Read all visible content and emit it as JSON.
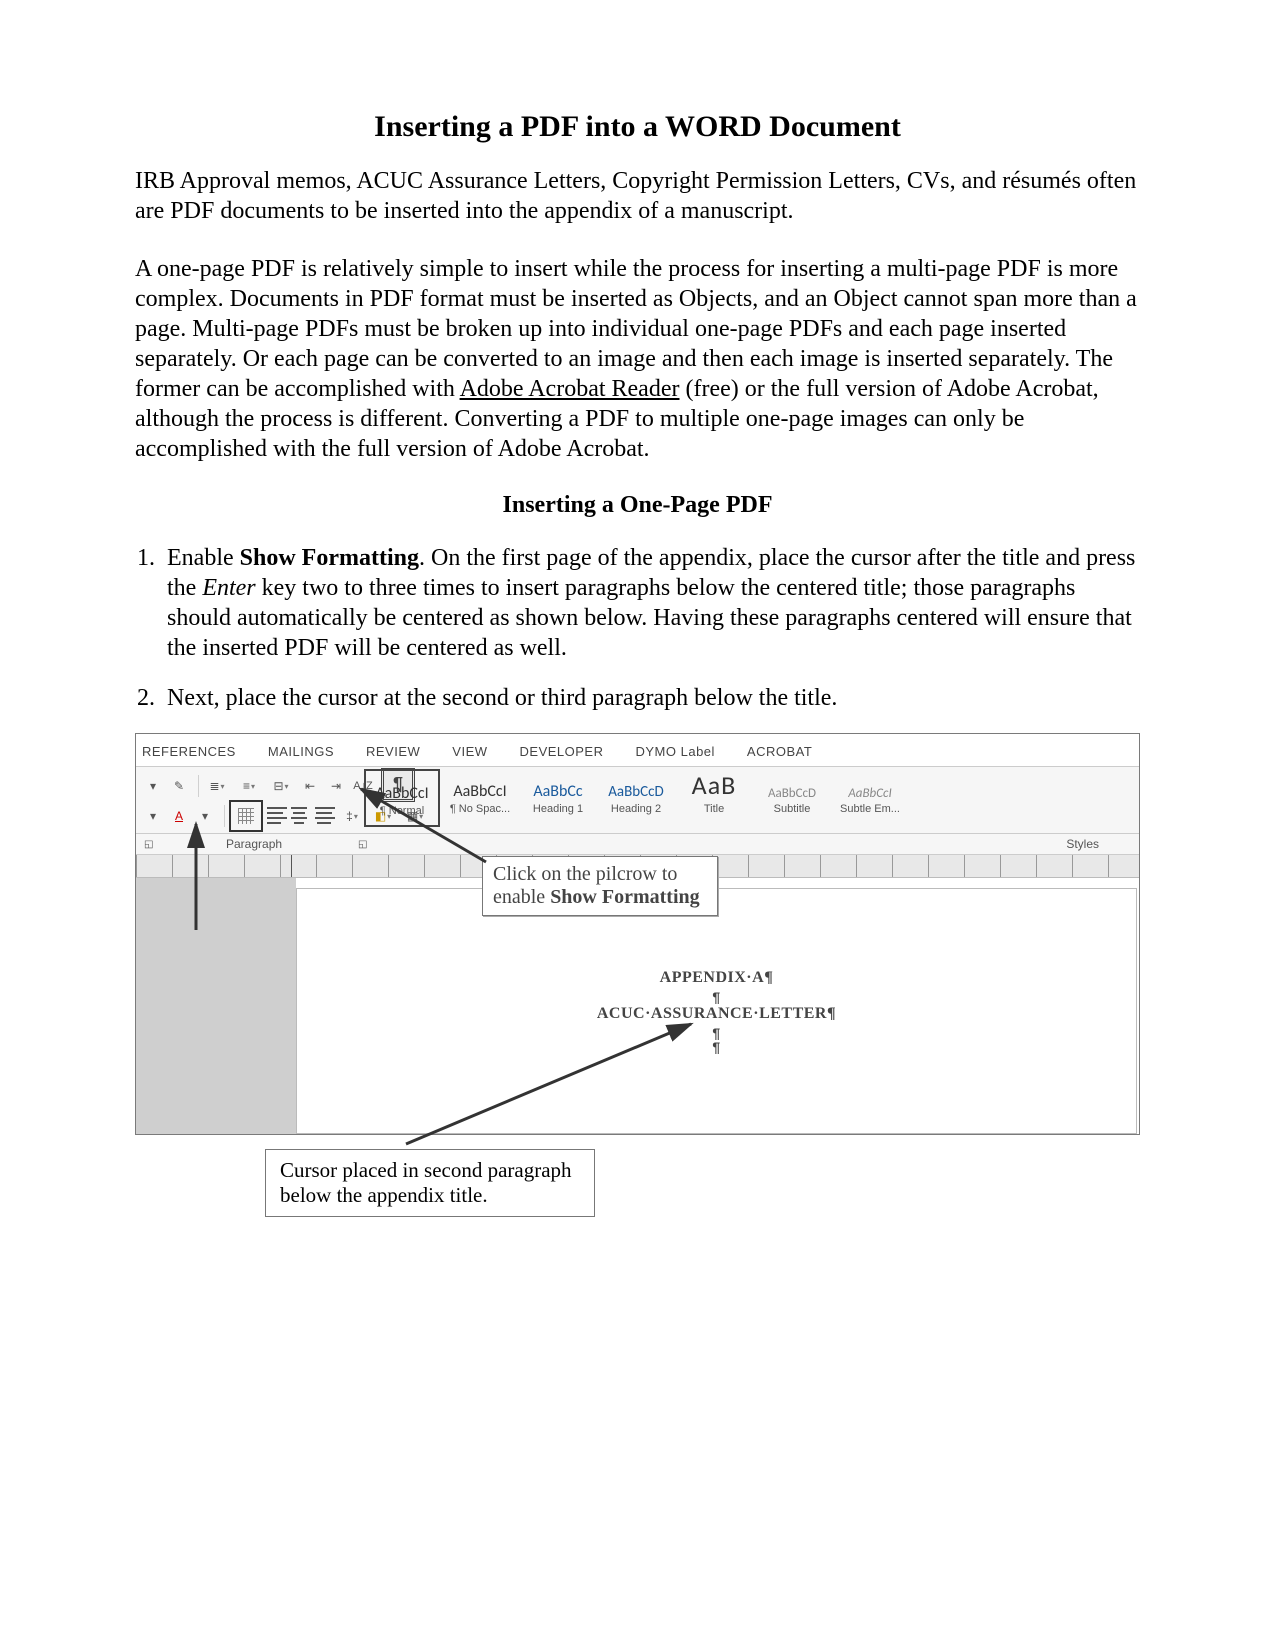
{
  "title": "Inserting a PDF into a WORD Document",
  "intro": "IRB Approval memos, ACUC Assurance Letters, Copyright Permission Letters, CVs, and résumés often are PDF documents to be inserted into the appendix of a manuscript.",
  "para2_a": "A one-page PDF is relatively simple to insert while the process for inserting a multi-page PDF is more complex. Documents in PDF format must be inserted as Objects, and an Object cannot span more than a page. Multi-page PDFs must be broken up into individual one-page PDFs and each page inserted separately. Or each page can be converted to an image and then each image is inserted separately. The former can be accomplished with ",
  "para2_link": "Adobe Acrobat Reader",
  "para2_b": " (free) or the full version of Adobe Acrobat, although the process is different. Converting a PDF to multiple one-page images can only be accomplished with the full version of Adobe Acrobat.",
  "subheading": "Inserting a One-Page PDF",
  "steps": {
    "s1_a": "Enable ",
    "s1_bold": "Show Formatting",
    "s1_b": ". On the first page of the appendix, place the cursor after the title and press the ",
    "s1_italic": "Enter",
    "s1_c": " key two to three times to insert paragraphs below the centered title; those paragraphs should automatically be centered as shown below. Having these paragraphs centered will ensure that the inserted PDF will be centered as well.",
    "s2": "Next, place the cursor at the second or third paragraph below the title."
  },
  "word": {
    "tabs": [
      "REFERENCES",
      "MAILINGS",
      "REVIEW",
      "VIEW",
      "DEVELOPER",
      "DYMO Label",
      "ACROBAT"
    ],
    "az": "A↓Z",
    "pilcrow": "¶",
    "para_label": "Paragraph",
    "styles_label": "Styles",
    "styles": [
      {
        "preview": "AaBbCcI",
        "cls": "normal",
        "label": "¶ Normal",
        "sel": true
      },
      {
        "preview": "AaBbCcI",
        "cls": "normal",
        "label": "¶ No Spac..."
      },
      {
        "preview": "AaBbCc",
        "cls": "h1",
        "label": "Heading 1"
      },
      {
        "preview": "AaBbCcD",
        "cls": "h2",
        "label": "Heading 2"
      },
      {
        "preview": "AaB",
        "cls": "title",
        "label": "Title"
      },
      {
        "preview": "AaBbCcD",
        "cls": "subtitle",
        "label": "Subtitle"
      },
      {
        "preview": "AaBbCcI",
        "cls": "subtleem",
        "label": "Subtle Em..."
      }
    ],
    "doc": {
      "line1": "APPENDIX·A¶",
      "line2": "¶",
      "line3": "ACUC·ASSURANCE·LETTER¶",
      "line4": "¶",
      "line5": "¶"
    },
    "callout1_a": "Click on the pilcrow to enable ",
    "callout1_b": "Show Formatting",
    "callout2": "Cursor placed in second paragraph below the appendix title."
  }
}
